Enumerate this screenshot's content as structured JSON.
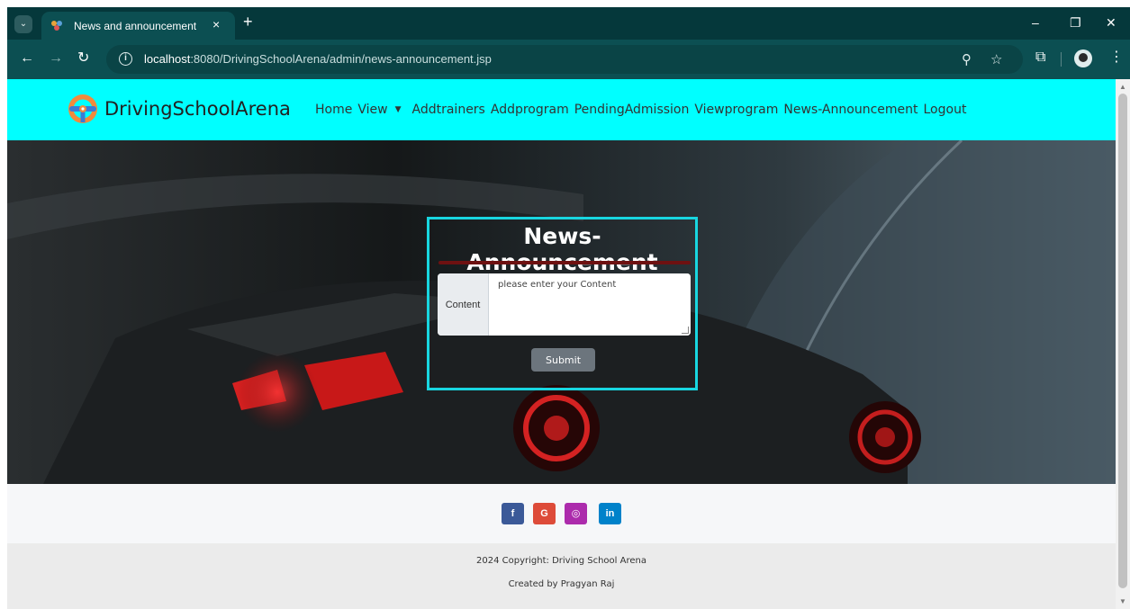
{
  "browser": {
    "tab_title": "News and announcement",
    "tab_close": "×",
    "new_tab": "+",
    "url_host": "localhost",
    "url_rest": ":8080/DrivingSchoolArena/admin/news-announcement.jsp",
    "minimize": "–",
    "restore": "❐",
    "close": "✕",
    "back": "←",
    "forward": "→",
    "reload": "↻",
    "tab_list": "⌄",
    "info": "i",
    "zoom_icon": "⚲",
    "bookmark": "☆",
    "extensions": "⧉",
    "menu": "⋮"
  },
  "site": {
    "brand": "DrivingSchoolArena",
    "nav": {
      "home": "Home",
      "view": "View",
      "addtrainers": "Addtrainers",
      "addprogram": "Addprogram",
      "pendingadmission": "PendingAdmission",
      "viewprogram": "Viewprogram",
      "news": "News-Announcement",
      "logout": "Logout"
    }
  },
  "form": {
    "title": "News-Announcement",
    "content_label": "Content",
    "content_placeholder": "please enter your Content",
    "submit_label": "Submit"
  },
  "footer": {
    "social": {
      "facebook": "f",
      "google": "G",
      "instagram": "◎",
      "linkedin": "in"
    },
    "copyright": "2024 Copyright: Driving School Arena",
    "credit": "Created by Pragyan Raj"
  },
  "colors": {
    "browser_frame": "#05383b",
    "toolbar": "#0c4f52",
    "navbar": "#00ffff",
    "card_border": "#18d6e0",
    "title_rule": "#6e1111",
    "submit": "#6c757d",
    "facebook": "#3b5998",
    "google": "#dd4b39",
    "instagram": "#ac2bac",
    "linkedin": "#0082ca"
  }
}
